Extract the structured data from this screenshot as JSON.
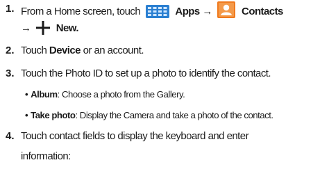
{
  "steps": [
    {
      "number": "1.",
      "touch": "From a Home screen, touch",
      "apps_label": "Apps",
      "arrow1": "→",
      "contacts_label": "Contacts",
      "arrow2": "→",
      "new_label": "New."
    },
    {
      "number": "2.",
      "pre": "Touch ",
      "device_label": "Device",
      "post": " or an account."
    },
    {
      "number": "3.",
      "text": "Touch the Photo ID to set up a photo to identify the contact.",
      "bullets": [
        {
          "term": "Album",
          "desc": ": Choose a photo from the Gallery."
        },
        {
          "term": "Take photo",
          "desc": ": Display the Camera and take a photo of the contact."
        }
      ]
    },
    {
      "number": "4.",
      "text_line1": "Touch contact fields to display the keyboard and enter",
      "text_line2": "information:"
    }
  ],
  "icons": {
    "apps": "apps-grid-icon",
    "contacts": "contacts-icon",
    "new": "plus-icon"
  },
  "colors": {
    "apps_icon": "#2a7fd1",
    "contacts_icon": "#f07a1e"
  }
}
